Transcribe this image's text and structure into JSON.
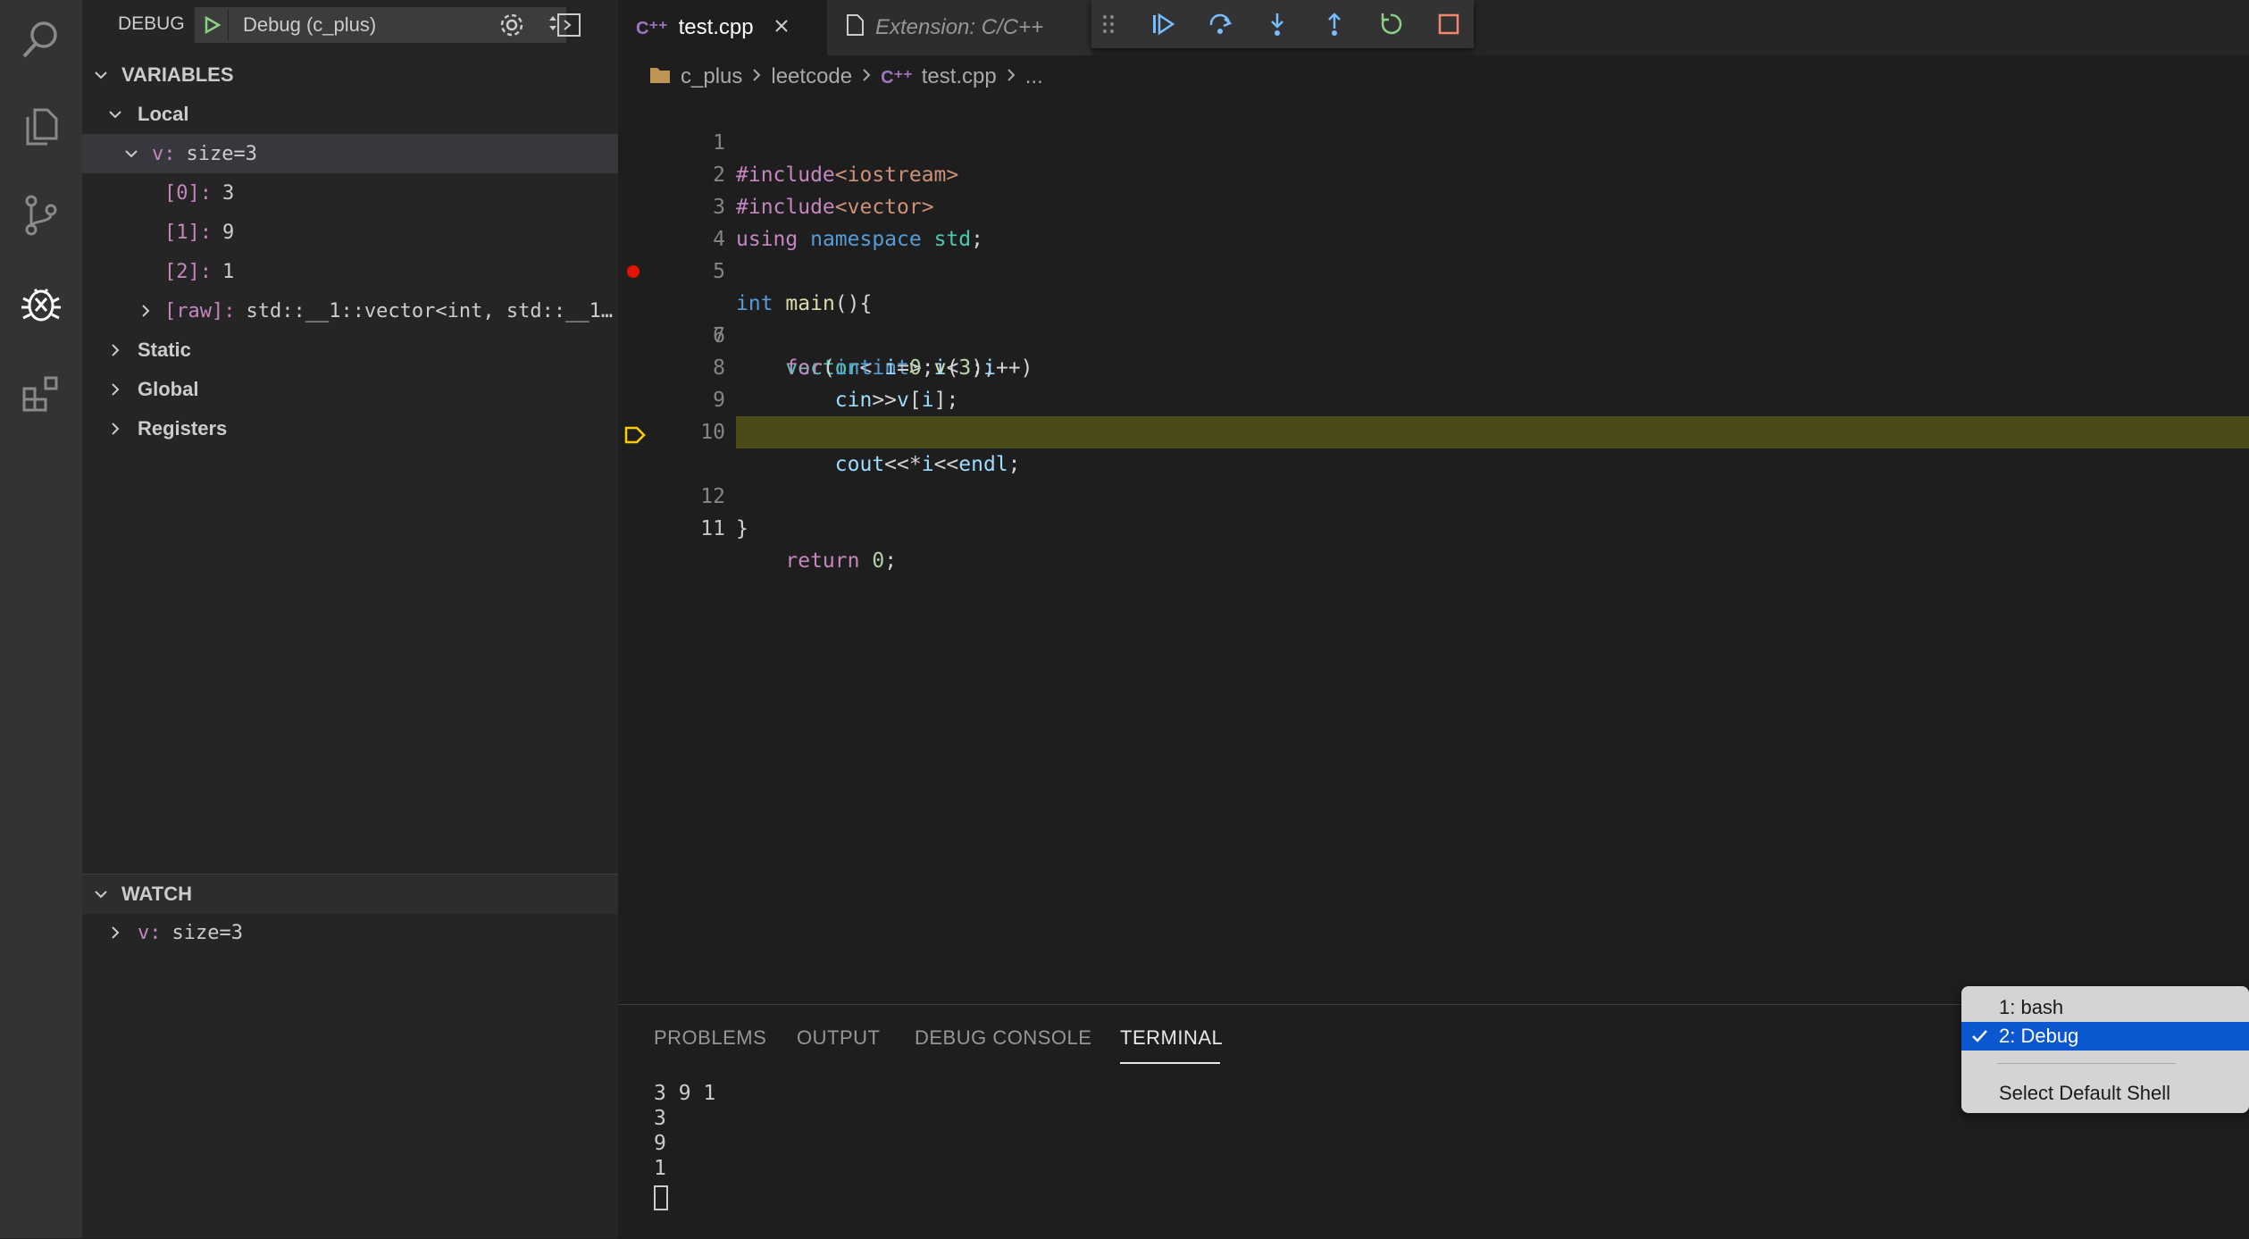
{
  "debug_bar": {
    "label": "DEBUG",
    "config": "Debug (c_plus)"
  },
  "variables": {
    "header": "VARIABLES",
    "local": "Local",
    "v_name": "v:",
    "v_value": "size=3",
    "items": [
      {
        "key": "[0]:",
        "value": "3"
      },
      {
        "key": "[1]:",
        "value": "9"
      },
      {
        "key": "[2]:",
        "value": "1"
      }
    ],
    "raw_key": "[raw]:",
    "raw_value": "std::__1::vector<int, std::__1…",
    "static": "Static",
    "global": "Global",
    "registers": "Registers"
  },
  "watch": {
    "header": "WATCH",
    "item_name": "v:",
    "item_value": "size=3"
  },
  "tabs": [
    {
      "label": "test.cpp",
      "active": true
    },
    {
      "label": "Extension: C/C++",
      "italic": true
    }
  ],
  "breadcrumb": {
    "folder": "c_plus",
    "sub": "leetcode",
    "file": "test.cpp",
    "more": "..."
  },
  "editor": {
    "line_numbers": [
      "1",
      "2",
      "3",
      "4",
      "5",
      "6",
      "7",
      "8",
      "9",
      "10",
      "11",
      "12"
    ],
    "breakpoint_line": "6",
    "current_line": "11"
  },
  "panel": {
    "tabs": [
      "PROBLEMS",
      "OUTPUT",
      "DEBUG CONSOLE",
      "TERMINAL"
    ],
    "active_tab": "TERMINAL",
    "terminal_lines": [
      "3 9 1",
      "3",
      "9",
      "1"
    ]
  },
  "shell_menu": {
    "items": [
      "1: bash",
      "2: Debug"
    ],
    "selected": "2: Debug",
    "footer": "Select Default Shell"
  },
  "colors": {
    "current_line_bg": "#4b4b18",
    "breakpoint": "#e51400",
    "menu_selected": "#0b57d0"
  }
}
